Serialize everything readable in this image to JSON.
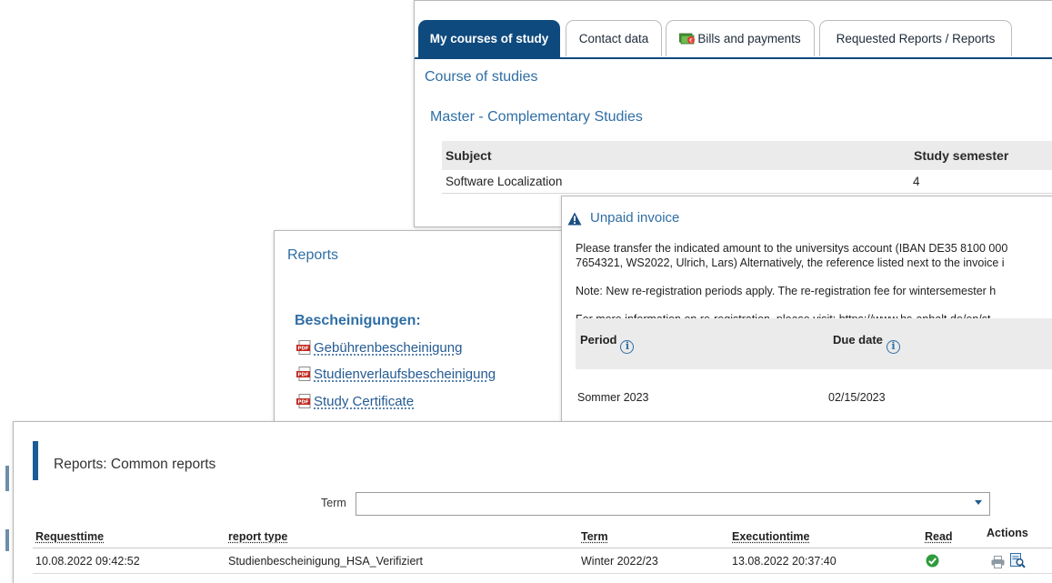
{
  "courses": {
    "tabs": [
      {
        "label": "My courses of study",
        "active": true
      },
      {
        "label": "Contact data",
        "active": false
      },
      {
        "label": "Bills and payments",
        "active": false
      },
      {
        "label": "Requested Reports / Reports",
        "active": false
      }
    ],
    "section_title": "Course of studies",
    "degree_title": "Master - Complementary Studies",
    "table": {
      "headers": [
        "Subject",
        "Study semester"
      ],
      "rows": [
        [
          "Software Localization",
          "4"
        ]
      ]
    }
  },
  "reports": {
    "title": "Reports",
    "section_label": "Bescheinigungen:",
    "links": [
      "Gebührenbescheinigung",
      "Studienverlaufsbescheinigung",
      "Study Certificate"
    ]
  },
  "invoice": {
    "title": "Unpaid invoice",
    "line1": "Please transfer the indicated amount to the universitys account (IBAN DE35 8100 000",
    "line2": "7654321, WS2022, Ulrich, Lars) Alternatively, the reference listed next to the invoice i",
    "line3": "Note: New re-registration periods apply. The re-registration fee for wintersemester h",
    "line4_prefix": "For more information on re-registration, please visit:",
    "line4_link": "https://www.hs-anhalt.de/en/st",
    "table": {
      "headers": [
        "Period",
        "Due date"
      ],
      "rows": [
        [
          "Sommer 2023",
          "02/15/2023"
        ]
      ]
    }
  },
  "common": {
    "title": "Reports: Common reports",
    "term_label": "Term",
    "term_value": "",
    "table": {
      "headers": [
        "Requesttime",
        "report type",
        "Term",
        "Executiontime",
        "Read",
        "Actions"
      ],
      "rows": [
        [
          "10.08.2022 09:42:52",
          "Studienbescheinigung_HSA_Verifiziert",
          "Winter 2022/23",
          "13.08.2022 20:37:40"
        ]
      ]
    }
  },
  "colors": {
    "tab_active": "#0e4a7e",
    "link_blue": "#245b93",
    "heading_blue": "#2f6ea5",
    "check_green": "#2e9b3c"
  }
}
